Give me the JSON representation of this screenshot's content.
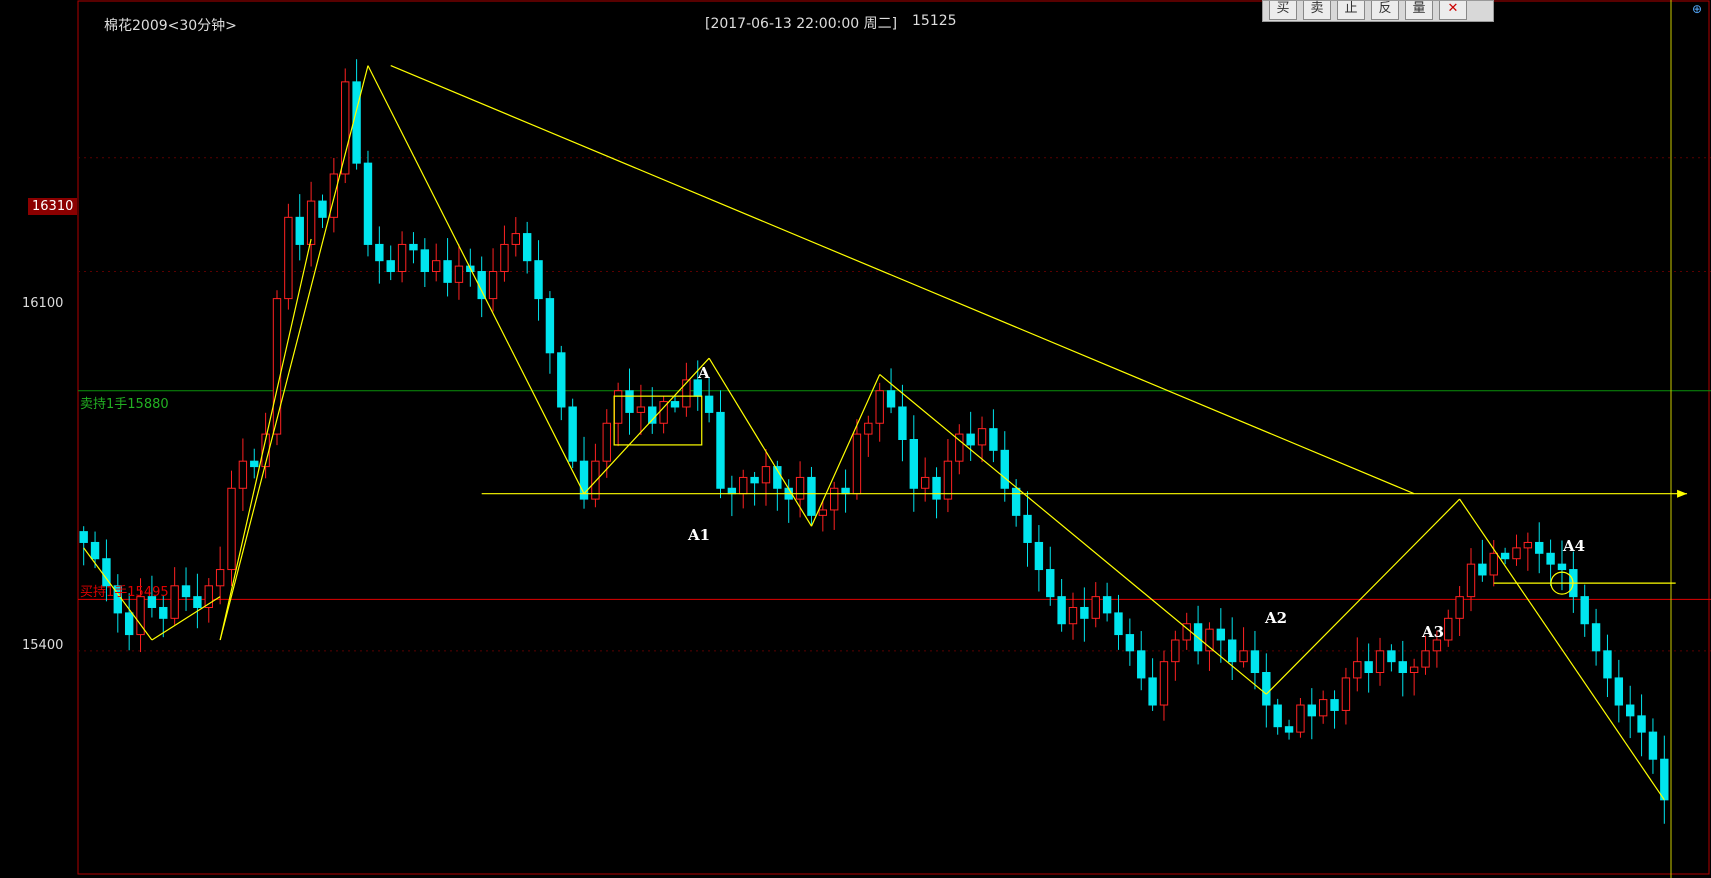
{
  "header": {
    "title": "棉花2009<30分钟>",
    "datetime": "[2017-06-13  22:00:00 周二]",
    "last_price": "15125"
  },
  "toolbar": {
    "buttons": [
      {
        "label": "买",
        "icon": "buy"
      },
      {
        "label": "卖",
        "icon": "sell"
      },
      {
        "label": "止",
        "icon": "stop"
      },
      {
        "label": "反",
        "icon": "reverse"
      },
      {
        "label": "量",
        "icon": "volume"
      }
    ],
    "close_label": "✕"
  },
  "price_axis": {
    "highlight": "16310",
    "labels": [
      "16100",
      "15400"
    ]
  },
  "lines": {
    "sell_label": "卖持1手15880",
    "buy_label": "买持1手15495"
  },
  "annotations": {
    "A": "A",
    "A1": "A1",
    "A2": "A2",
    "A3": "A3",
    "A4": "A4"
  },
  "colors": {
    "up_candle": "#ff2222",
    "down_candle": "#00e5ee",
    "trendline": "#ffff00",
    "sell_line": "#0b8f0b",
    "buy_line": "#e00000",
    "background": "#000000"
  },
  "chart_data": {
    "type": "candlestick",
    "title": "棉花2009<30分钟>",
    "ylim": [
      14990,
      16590
    ],
    "hlines": [
      {
        "label": "卖持1手15880",
        "value": 15880,
        "color": "#0b8f0b"
      },
      {
        "label": "买持1手15495",
        "value": 15495,
        "color": "#e00000"
      }
    ],
    "closes": [
      15600,
      15570,
      15520,
      15470,
      15430,
      15500,
      15480,
      15460,
      15520,
      15500,
      15480,
      15520,
      15550,
      15700,
      15750,
      15740,
      15800,
      16050,
      16200,
      16150,
      16230,
      16200,
      16280,
      16450,
      16300,
      16150,
      16120,
      16100,
      16150,
      16140,
      16100,
      16120,
      16080,
      16110,
      16100,
      16050,
      16100,
      16150,
      16170,
      16120,
      16050,
      15950,
      15850,
      15750,
      15680,
      15750,
      15820,
      15880,
      15840,
      15850,
      15820,
      15860,
      15850,
      15900,
      15870,
      15840,
      15700,
      15690,
      15720,
      15710,
      15740,
      15700,
      15680,
      15720,
      15650,
      15660,
      15700,
      15690,
      15800,
      15820,
      15880,
      15850,
      15790,
      15700,
      15720,
      15680,
      15750,
      15800,
      15780,
      15810,
      15770,
      15700,
      15650,
      15600,
      15550,
      15500,
      15450,
      15480,
      15460,
      15500,
      15470,
      15430,
      15400,
      15350,
      15300,
      15380,
      15420,
      15450,
      15400,
      15440,
      15420,
      15380,
      15400,
      15360,
      15300,
      15260,
      15250,
      15300,
      15280,
      15310,
      15290,
      15350,
      15380,
      15360,
      15400,
      15380,
      15360,
      15370,
      15400,
      15420,
      15460,
      15500,
      15560,
      15540,
      15580,
      15570,
      15590,
      15600,
      15580,
      15560,
      15550,
      15500,
      15450,
      15400,
      15350,
      15300,
      15280,
      15250,
      15200,
      15125
    ],
    "trendlines": [
      {
        "from": [
          0,
          15590
        ],
        "to": [
          6,
          15420
        ]
      },
      {
        "from": [
          6,
          15420
        ],
        "to": [
          12,
          15500
        ]
      },
      {
        "from": [
          12,
          15420
        ],
        "to": [
          20,
          16160
        ]
      },
      {
        "from": [
          12,
          15420
        ],
        "to": [
          25,
          16480
        ]
      },
      {
        "from": [
          25,
          16480
        ],
        "to": [
          44,
          15690
        ]
      },
      {
        "from": [
          27,
          16480
        ],
        "to": [
          117,
          15690
        ]
      },
      {
        "from": [
          44,
          15690
        ],
        "to": [
          55,
          15940
        ]
      },
      {
        "from": [
          55,
          15940
        ],
        "to": [
          64,
          15630
        ]
      },
      {
        "from": [
          64,
          15630
        ],
        "to": [
          70,
          15910
        ]
      },
      {
        "from": [
          70,
          15910
        ],
        "to": [
          104,
          15320
        ]
      },
      {
        "from": [
          104,
          15320
        ],
        "to": [
          121,
          15680
        ]
      },
      {
        "from": [
          121,
          15680
        ],
        "to": [
          139,
          15125
        ]
      }
    ],
    "horizontal_ray": {
      "y": 15690,
      "from_x": 35,
      "to_x": 141
    }
  }
}
